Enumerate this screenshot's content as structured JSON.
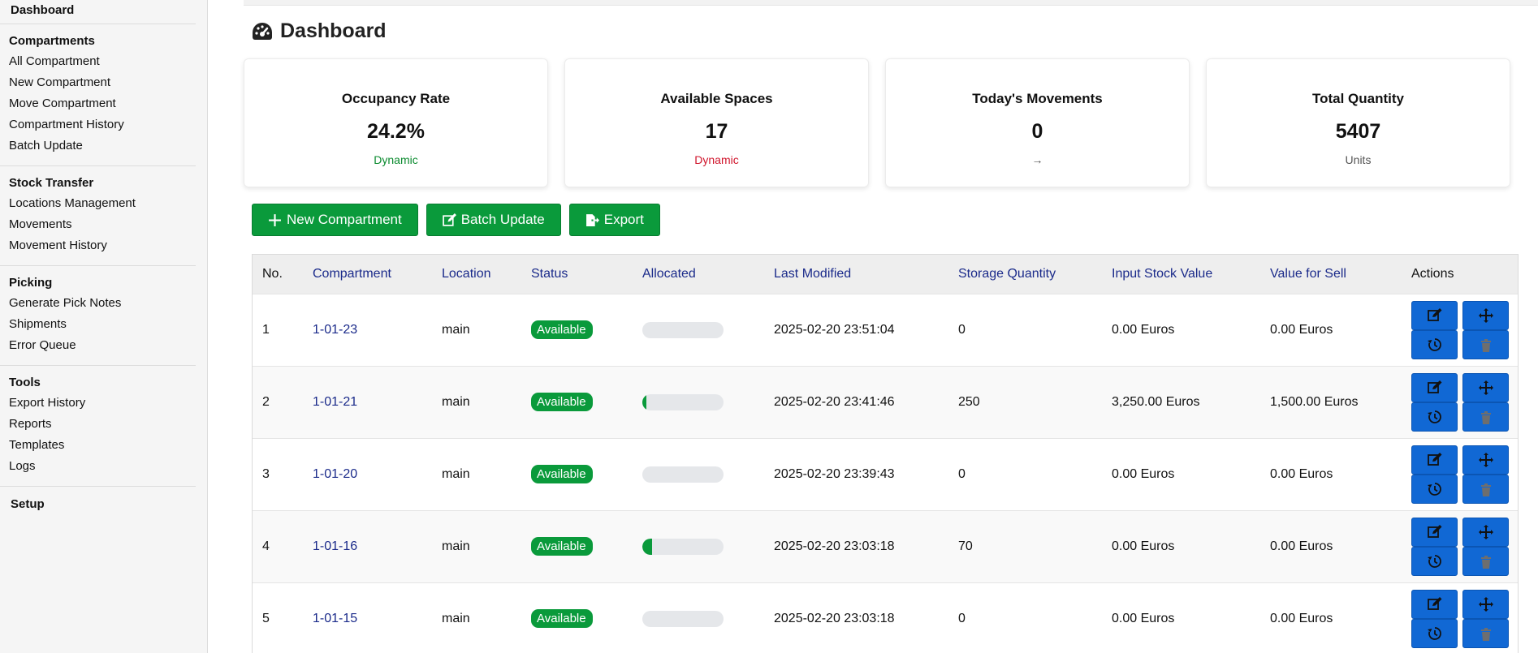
{
  "sidebar": {
    "top": "Dashboard",
    "sections": [
      {
        "title": "Compartments",
        "items": [
          "All Compartment",
          "New Compartment",
          "Move Compartment",
          "Compartment History",
          "Batch Update"
        ]
      },
      {
        "title": "Stock Transfer",
        "items": [
          "Locations Management",
          "Movements",
          "Movement History"
        ]
      },
      {
        "title": "Picking",
        "items": [
          "Generate Pick Notes",
          "Shipments",
          "Error Queue"
        ]
      },
      {
        "title": "Tools",
        "items": [
          "Export History",
          "Reports",
          "Templates",
          "Logs"
        ]
      }
    ],
    "setup": "Setup"
  },
  "page": {
    "title": "Dashboard",
    "icon": "gauge-icon"
  },
  "cards": [
    {
      "title": "Occupancy Rate",
      "value": "24.2%",
      "sub": "Dynamic",
      "sub_color": "#0a8a2e"
    },
    {
      "title": "Available Spaces",
      "value": "17",
      "sub": "Dynamic",
      "sub_color": "#d0152c"
    },
    {
      "title": "Today's Movements",
      "value": "0",
      "sub": "→",
      "sub_color": "#555555"
    },
    {
      "title": "Total Quantity",
      "value": "5407",
      "sub": "Units",
      "sub_color": "#555555"
    }
  ],
  "toolbar": {
    "new_label": "New Compartment",
    "batch_label": "Batch Update",
    "export_label": "Export"
  },
  "table": {
    "headers": [
      "No.",
      "Compartment",
      "Location",
      "Status",
      "Allocated",
      "Last Modified",
      "Storage Quantity",
      "Input Stock Value",
      "Value for Sell",
      "Actions"
    ],
    "rows": [
      {
        "no": "1",
        "compartment": "1-01-23",
        "location": "main",
        "status": "Available",
        "allocated": 0,
        "modified": "2025-02-20 23:51:04",
        "qty": "0",
        "input_value": "0.00 Euros",
        "sell_value": "0.00 Euros"
      },
      {
        "no": "2",
        "compartment": "1-01-21",
        "location": "main",
        "status": "Available",
        "allocated": 0.05,
        "modified": "2025-02-20 23:41:46",
        "qty": "250",
        "input_value": "3,250.00 Euros",
        "sell_value": "1,500.00 Euros"
      },
      {
        "no": "3",
        "compartment": "1-01-20",
        "location": "main",
        "status": "Available",
        "allocated": 0,
        "modified": "2025-02-20 23:39:43",
        "qty": "0",
        "input_value": "0.00 Euros",
        "sell_value": "0.00 Euros"
      },
      {
        "no": "4",
        "compartment": "1-01-16",
        "location": "main",
        "status": "Available",
        "allocated": 0.12,
        "modified": "2025-02-20 23:03:18",
        "qty": "70",
        "input_value": "0.00 Euros",
        "sell_value": "0.00 Euros"
      },
      {
        "no": "5",
        "compartment": "1-01-15",
        "location": "main",
        "status": "Available",
        "allocated": 0,
        "modified": "2025-02-20 23:03:18",
        "qty": "0",
        "input_value": "0.00 Euros",
        "sell_value": "0.00 Euros"
      }
    ],
    "action_icons": [
      "edit-icon",
      "move-icon",
      "history-icon",
      "delete-icon"
    ]
  },
  "colors": {
    "brand_green": "#0a9a3b",
    "action_blue": "#1168d4",
    "link_navy": "#1a2a8a"
  }
}
